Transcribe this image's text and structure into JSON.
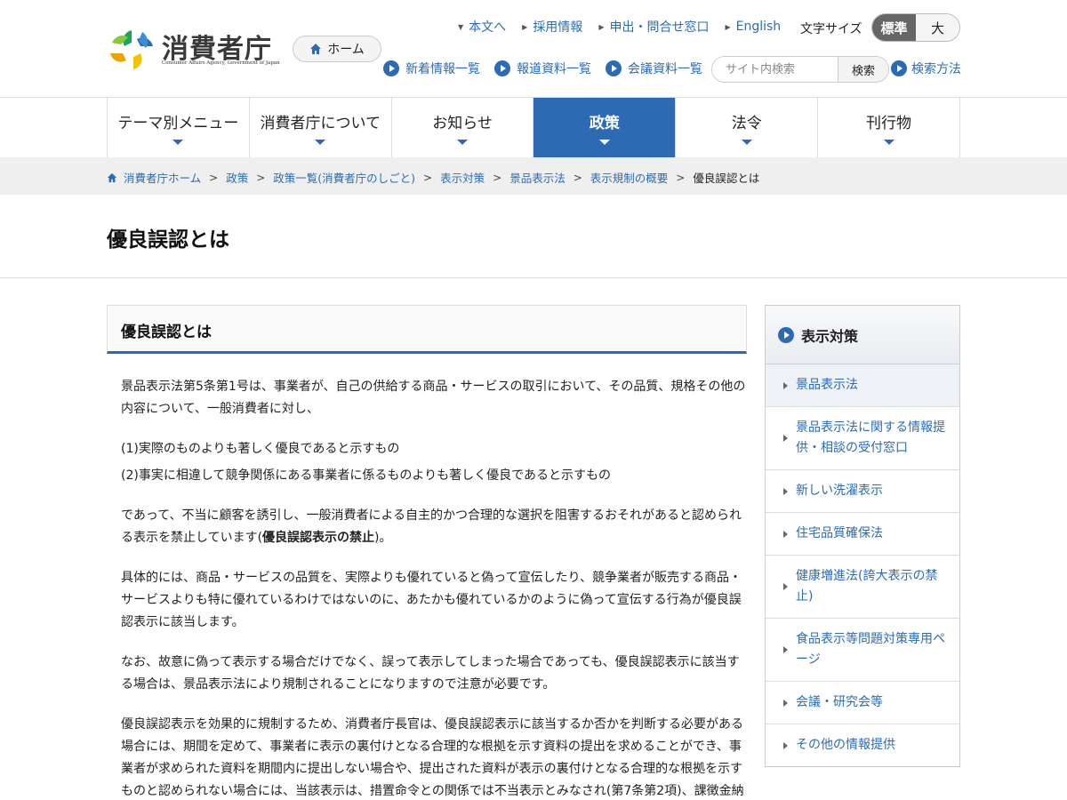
{
  "header": {
    "logo_text": "消費者庁",
    "logo_sub": "Consumer Affairs Agency, Government of Japan",
    "home_label": "ホーム",
    "top_links": [
      "本文へ",
      "採用情報",
      "申出・問合せ窓口",
      "English"
    ],
    "font_size_label": "文字サイズ",
    "font_size_standard": "標準",
    "font_size_large": "大",
    "sub_links": [
      "新着情報一覧",
      "報道資料一覧",
      "会議資料一覧"
    ],
    "search_placeholder": "サイト内検索",
    "search_button": "検索",
    "search_method": "検索方法"
  },
  "nav": [
    "テーマ別メニュー",
    "消費者庁について",
    "お知らせ",
    "政策",
    "法令",
    "刊行物"
  ],
  "nav_active": "政策",
  "breadcrumb": [
    "消費者庁ホーム",
    "政策",
    "政策一覧(消費者庁のしごと)",
    "表示対策",
    "景品表示法",
    "表示規制の概要"
  ],
  "breadcrumb_current": "優良誤認とは",
  "page_title": "優良誤認とは",
  "content": {
    "heading": "優良誤認とは",
    "p1": "景品表示法第5条第1号は、事業者が、自己の供給する商品・サービスの取引において、その品質、規格その他の内容について、一般消費者に対し、",
    "item1": "(1)実際のものよりも著しく優良であると示すもの",
    "item2": "(2)事実に相違して競争関係にある事業者に係るものよりも著しく優良であると示すもの",
    "p2_pre": "であって、不当に顧客を誘引し、一般消費者による自主的かつ合理的な選択を阻害するおそれがあると認められる表示を禁止しています(",
    "p2_bold": "優良誤認表示の禁止",
    "p2_post": ")。",
    "p3": "具体的には、商品・サービスの品質を、実際よりも優れていると偽って宣伝したり、競争業者が販売する商品・サービスよりも特に優れているわけではないのに、あたかも優れているかのように偽って宣伝する行為が優良誤認表示に該当します。",
    "p4": "なお、故意に偽って表示する場合だけでなく、誤って表示してしまった場合であっても、優良誤認表示に該当する場合は、景品表示法により規制されることになりますので注意が必要です。",
    "p5": "優良誤認表示を効果的に規制するため、消費者庁長官は、優良誤認表示に該当するか否かを判断する必要がある場合には、期間を定めて、事業者に表示の裏付けとなる合理的な根拠を示す資料の提出を求めることができ、事業者が求められた資料を期間内に提出しない場合や、提出された資料が表示の裏付けとなる合理的な根拠を示すものと認められない場合には、当該表示は、措置命令との関係では不当表示とみなされ(第7条第2項)、課徴金納"
  },
  "sidebar": {
    "title": "表示対策",
    "items": [
      "景品表示法",
      "景品表示法に関する情報提供・相談の受付窓口",
      "新しい洗濯表示",
      "住宅品質確保法",
      "健康増進法(誇大表示の禁止)",
      "食品表示等問題対策専用ページ",
      "会議・研究会等",
      "その他の情報提供"
    ],
    "selected": "景品表示法"
  },
  "colors": {
    "accent": "#2c6bb4",
    "nav_active_bg": "#2d6ab3"
  }
}
